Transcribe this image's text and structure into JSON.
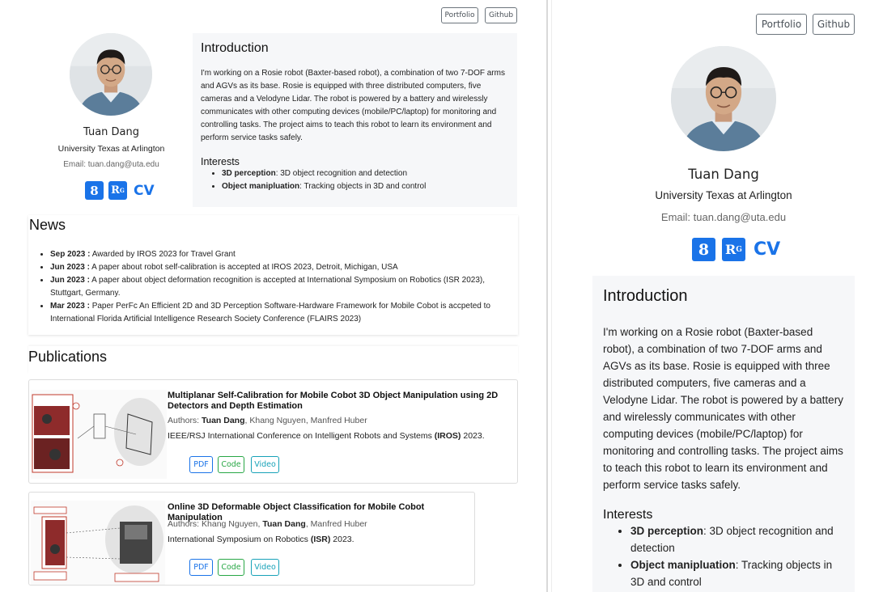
{
  "nav": {
    "portfolio": "Portfolio",
    "github": "Github"
  },
  "profile": {
    "name": "Tuan Dang",
    "affiliation": "University Texas at Arlington",
    "email": "Email: tuan.dang@uta.edu",
    "icons": {
      "scholar": "8",
      "researchgate": "R",
      "rg_sup": "G",
      "cv": "CV"
    }
  },
  "intro": {
    "heading": "Introduction",
    "text": "I'm working on a Rosie robot (Baxter-based robot), a combination of two 7-DOF arms and AGVs as its base. Rosie is equipped with three distributed computers, five cameras and a Velodyne Lidar. The robot is powered by a battery and wirelessly communicates with other computing devices (mobile/PC/laptop) for monitoring and controlling tasks. The project aims to teach this robot to learn its environment and perform service tasks safely.",
    "interests_heading": "Interests",
    "interests": [
      {
        "label": "3D perception",
        "desc": ": 3D object recognition and detection"
      },
      {
        "label": "Object manipluation",
        "desc": ": Tracking objects in 3D and control"
      }
    ]
  },
  "news": {
    "heading": "News",
    "items": [
      {
        "date": "Sep 2023 :",
        "text": " Awarded by IROS 2023 for Travel Grant"
      },
      {
        "date": "Jun 2023 :",
        "text": " A paper about robot self-calibration is accepted at IROS 2023, Detroit, Michigan, USA"
      },
      {
        "date": "Jun 2023 :",
        "text": " A paper about object deformation recognition is accepted at International Symposium on Robotics (ISR 2023), Stuttgart, Germany."
      },
      {
        "date": "Mar 2023 :",
        "text": " Paper PerFc An Efficient 2D and 3D Perception Software-Hardware Framework for Mobile Cobot is accpeted to International Florida Artificial Intelligence Research Society Conference (FLAIRS 2023)"
      }
    ]
  },
  "publications": {
    "heading": "Publications",
    "items": [
      {
        "title": "Multiplanar Self-Calibration for Mobile Cobot 3D Object Manipulation using 2D Detectors and Depth Estimation",
        "authors_prefix": "Authors: ",
        "author_bold": "Tuan Dang",
        "authors_rest": ", Khang Nguyen, Manfred Huber",
        "venue_prefix": "IEEE/RSJ International Conference on Intelligent Robots and Systems ",
        "venue_bold": "(IROS)",
        "venue_suffix": " 2023.",
        "buttons": [
          "PDF",
          "Code",
          "Video"
        ]
      },
      {
        "title": "Online 3D Deformable Object Classification for Mobile Cobot Manipulation",
        "authors_prefix": "Authors: Khang Nguyen, ",
        "author_bold": "Tuan Dang",
        "authors_rest": ", Manfred Huber",
        "venue_prefix": "International Symposium on Robotics ",
        "venue_bold": "(ISR)",
        "venue_suffix": " 2023.",
        "buttons": [
          "PDF",
          "Code",
          "Video"
        ]
      }
    ]
  },
  "colors": {
    "accent": "#1a73e8",
    "card_bg": "#f6f7f9",
    "code": "#28a745",
    "video": "#17a2b8"
  }
}
